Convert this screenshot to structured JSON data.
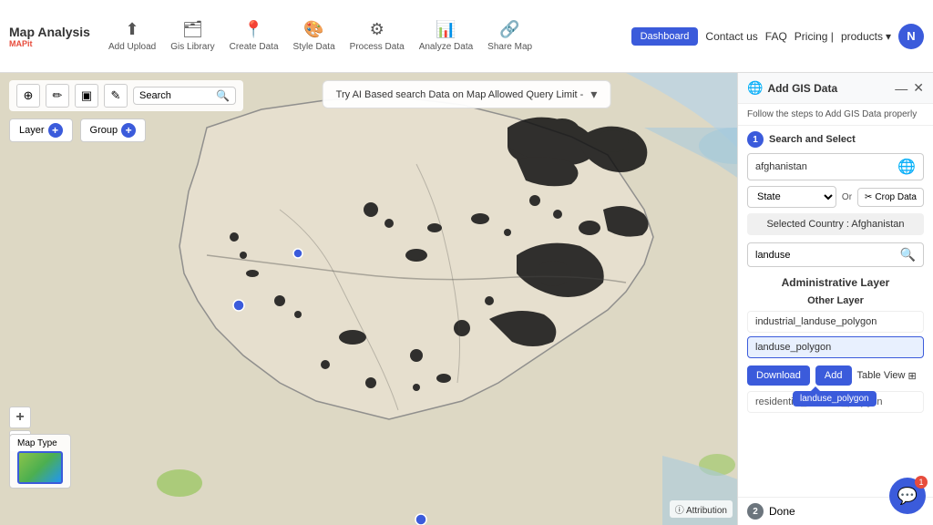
{
  "app": {
    "title": "Map Analysis",
    "logo_sub": "MAPit",
    "tagline": ""
  },
  "toolbar": {
    "items": [
      {
        "id": "add-upload",
        "icon": "⬆",
        "label": "Add Upload"
      },
      {
        "id": "gis-library",
        "icon": "🗂",
        "label": "Gis Library"
      },
      {
        "id": "create-data",
        "icon": "📍",
        "label": "Create Data"
      },
      {
        "id": "style-data",
        "icon": "🎨",
        "label": "Style Data"
      },
      {
        "id": "process-data",
        "icon": "⚙",
        "label": "Process Data"
      },
      {
        "id": "analyze-data",
        "icon": "📊",
        "label": "Analyze Data"
      },
      {
        "id": "share-map",
        "icon": "🔗",
        "label": "Share Map"
      }
    ]
  },
  "top_right_nav": {
    "dashboard": "Dashboard",
    "contact": "Contact us",
    "faq": "FAQ",
    "pricing": "Pricing |",
    "products": "products",
    "user_initial": "N"
  },
  "map_toolbar": {
    "search_placeholder": "Search",
    "tools": [
      "⊕",
      "🖊",
      "⬜",
      "✎"
    ]
  },
  "layer_controls": {
    "layer_label": "Layer",
    "group_label": "Group"
  },
  "ai_banner": {
    "text": "Try AI Based search Data on Map Allowed Query Limit -"
  },
  "zoom": {
    "plus": "+",
    "minus": "-"
  },
  "map_type": {
    "label": "Map Type"
  },
  "attribution": {
    "text": "ⓘ Attribution"
  },
  "right_panel": {
    "title": "Add GIS Data",
    "subtitle": "Follow the steps to Add GIS Data properly",
    "step1_label": "Search and Select",
    "step1_num": "1",
    "country_input_value": "afghanistan",
    "state_placeholder": "State",
    "or_label": "Or",
    "crop_data_label": "Crop Data",
    "selected_country_label": "Selected Country : Afghanistan",
    "layer_search_value": "landuse",
    "admin_layer_heading": "Administrative Layer",
    "other_layer_heading": "Other Layer",
    "layers": [
      {
        "id": "industrial-landuse",
        "name": "industrial_landuse_polygon"
      },
      {
        "id": "landuse-polygon",
        "name": "landuse_polygon",
        "active": true
      },
      {
        "id": "residential-landuse",
        "name": "residential_landuse_polygon"
      }
    ],
    "download_btn": "Download",
    "add_btn": "Add",
    "table_view_label": "Table View",
    "tooltip_text": "landuse_polygon",
    "step2_num": "2",
    "step2_label": "Done"
  },
  "chat": {
    "icon": "💬",
    "badge": "1"
  }
}
